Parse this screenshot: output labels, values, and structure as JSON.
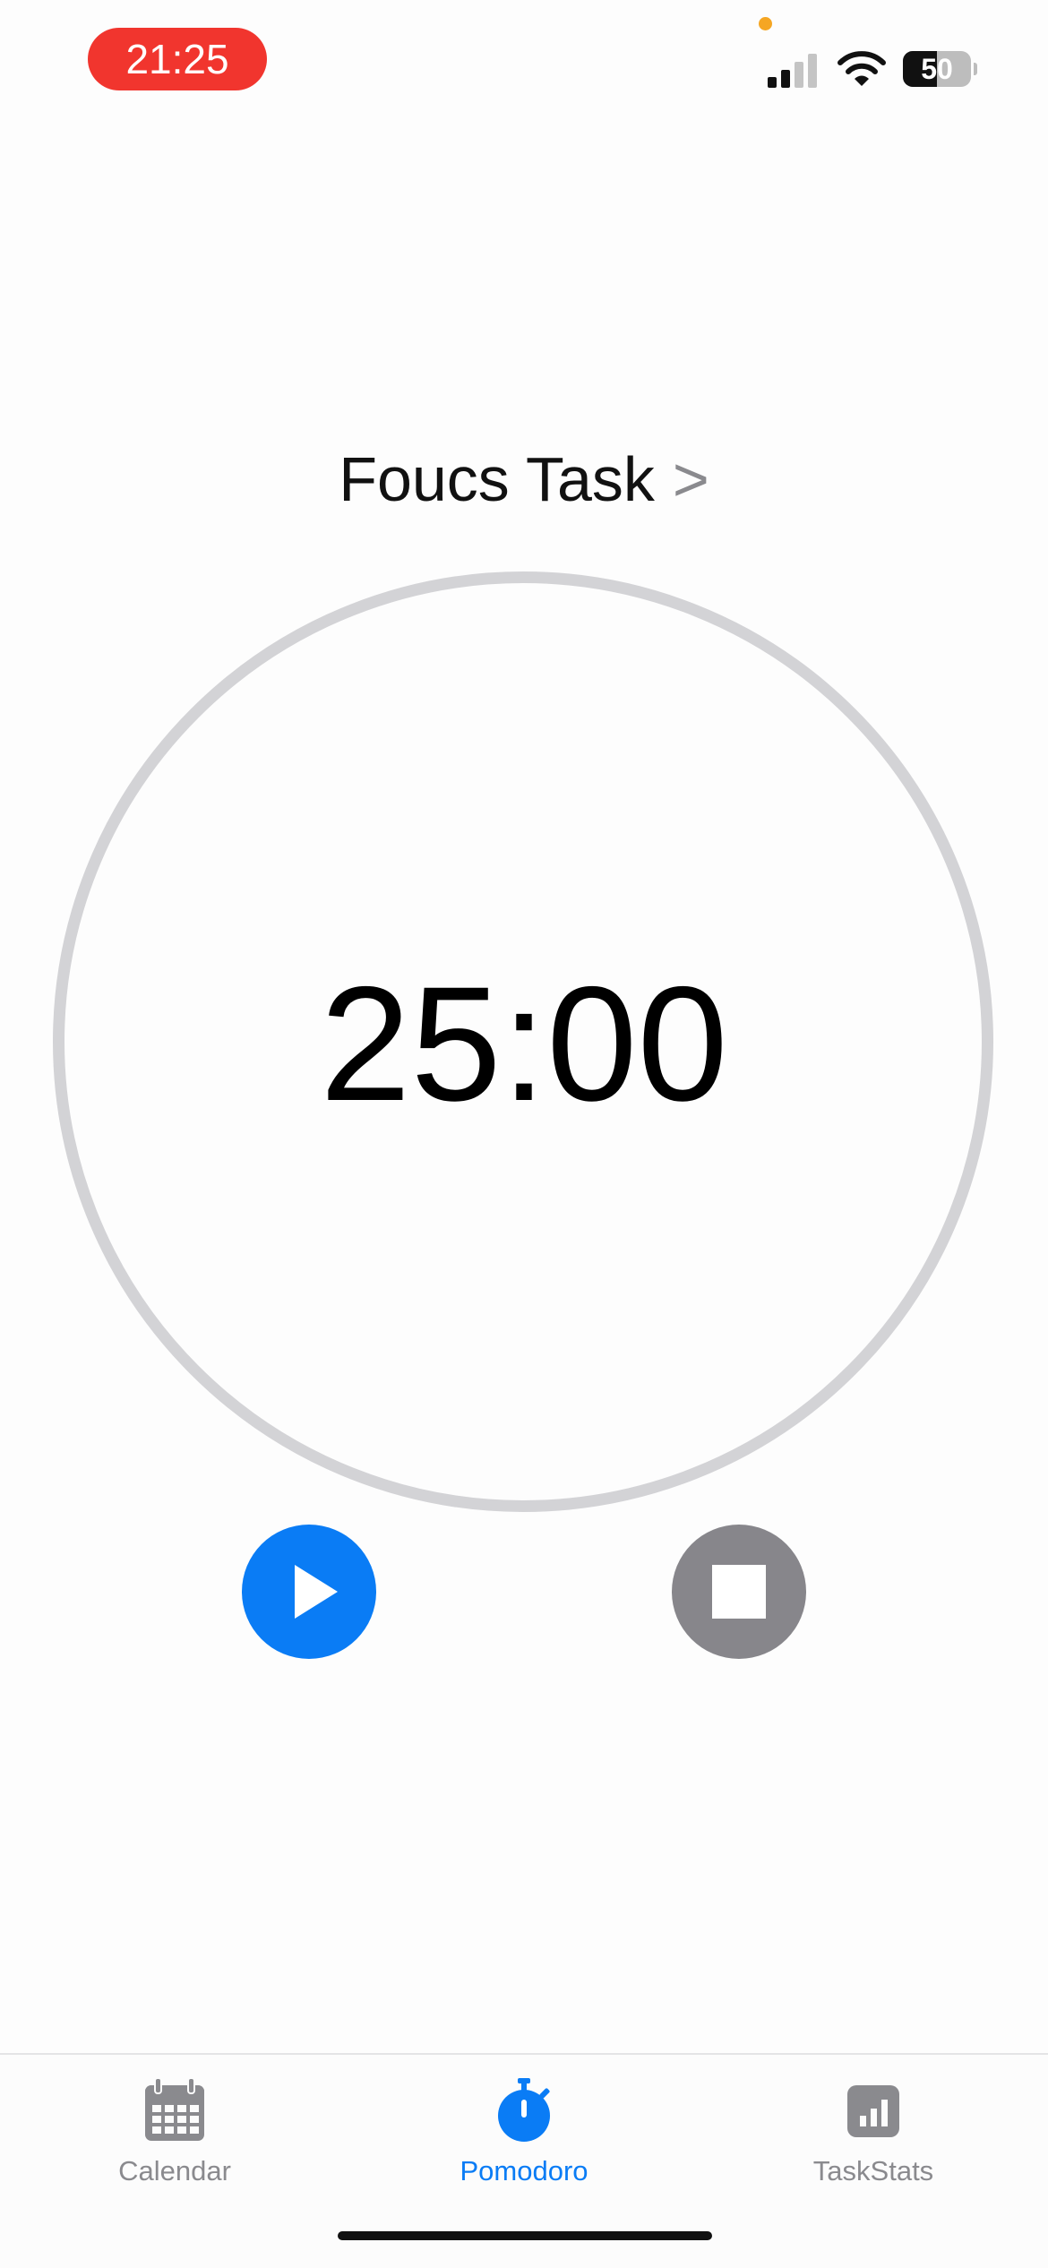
{
  "status_bar": {
    "time": "21:25",
    "battery_level": "50",
    "battery_fraction": 0.5,
    "signal_bars_active": 2,
    "signal_bars_total": 4
  },
  "focus_task": {
    "label": "Foucs Task",
    "chevron": ">"
  },
  "timer": {
    "display": "25:00"
  },
  "controls": {
    "play_icon": "play-icon",
    "stop_icon": "stop-icon"
  },
  "tab_bar": {
    "tabs": [
      {
        "label": "Calendar",
        "icon": "calendar-icon",
        "selected": false
      },
      {
        "label": "Pomodoro",
        "icon": "stopwatch-icon",
        "selected": true
      },
      {
        "label": "TaskStats",
        "icon": "chart-icon",
        "selected": false
      }
    ]
  },
  "colors": {
    "accent": "#0a7cf5",
    "recording_pill": "#f1352e",
    "inactive_tab": "#8a8a8e",
    "stop_button": "#87868b",
    "ring": "#d3d3d6"
  }
}
